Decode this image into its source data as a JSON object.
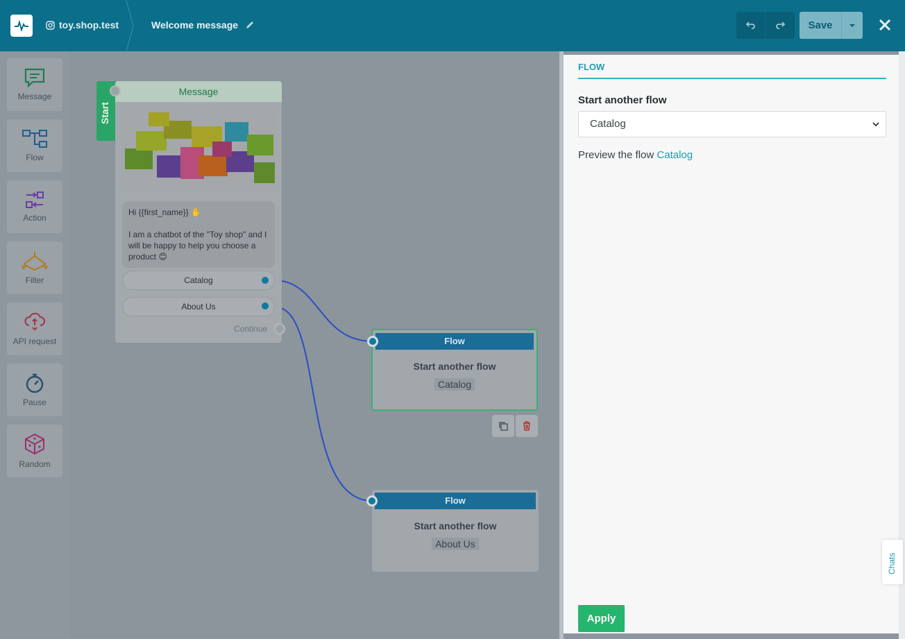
{
  "header": {
    "account_name": "toy.shop.test",
    "flow_name": "Welcome message",
    "save_label": "Save"
  },
  "palette": {
    "items": [
      {
        "label": "Message",
        "icon": "message-icon"
      },
      {
        "label": "Flow",
        "icon": "flow-icon"
      },
      {
        "label": "Action",
        "icon": "action-icon"
      },
      {
        "label": "Filter",
        "icon": "filter-icon"
      },
      {
        "label": "API request",
        "icon": "api-request-icon"
      },
      {
        "label": "Pause",
        "icon": "pause-icon"
      },
      {
        "label": "Random",
        "icon": "random-icon"
      }
    ]
  },
  "canvas": {
    "start_label": "Start",
    "message_node": {
      "title": "Message",
      "text_line1": "Hi {{first_name}} ✋",
      "text_body": "I am a chatbot of the \"Toy shop\" and I will be happy to help you choose a product 😊",
      "buttons": [
        "Catalog",
        "About Us"
      ],
      "continue_label": "Continue"
    },
    "flow_nodes": [
      {
        "title": "Flow",
        "subtitle": "Start another flow",
        "target": "Catalog"
      },
      {
        "title": "Flow",
        "subtitle": "Start another flow",
        "target": "About Us"
      }
    ]
  },
  "panel": {
    "tab": "FLOW",
    "field_label": "Start another flow",
    "selected_flow": "Catalog",
    "preview_prefix": "Preview the flow",
    "preview_link": "Catalog",
    "apply_label": "Apply"
  },
  "chats_label": "Chats",
  "colors": {
    "header": "#0b6e8a",
    "accent": "#1d9cb3",
    "apply": "#25b56d",
    "flow_head": "#1c6c98",
    "link_line": "#2a4fc4"
  }
}
